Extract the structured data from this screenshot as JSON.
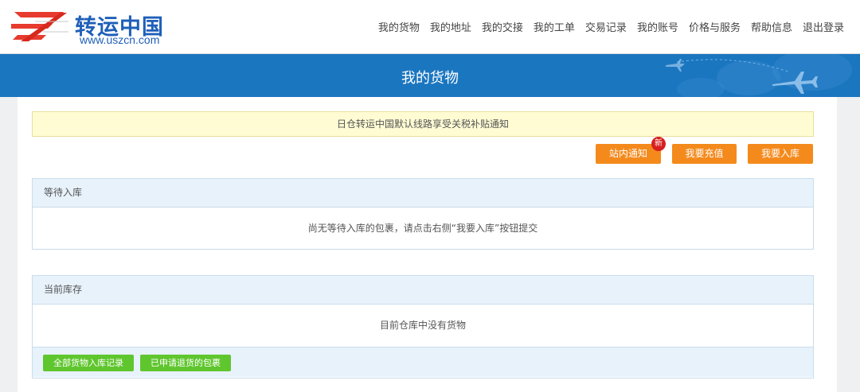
{
  "header": {
    "logo_cn": "转运中国",
    "logo_url": "www.uszcn.com",
    "nav": [
      "我的货物",
      "我的地址",
      "我的交接",
      "我的工单",
      "交易记录",
      "我的账号",
      "价格与服务",
      "帮助信息",
      "退出登录"
    ]
  },
  "banner": {
    "title": "我的货物"
  },
  "notice": {
    "text": "日仓转运中国默认线路享受关税补贴通知"
  },
  "actions": {
    "notify_label": "站内通知",
    "notify_badge": "新",
    "recharge_label": "我要充值",
    "inbound_label": "我要入库"
  },
  "pending": {
    "title": "等待入库",
    "empty_text": "尚无等待入库的包裹，请点击右侧“我要入库”按钮提交"
  },
  "stock": {
    "title": "当前库存",
    "empty_text": "目前仓库中没有货物",
    "all_records_label": "全部货物入库记录",
    "returns_label": "已申请退货的包裹"
  },
  "colors": {
    "brand_blue": "#1b76c0",
    "accent_orange": "#f48a1c",
    "accent_green": "#5fc62e"
  }
}
